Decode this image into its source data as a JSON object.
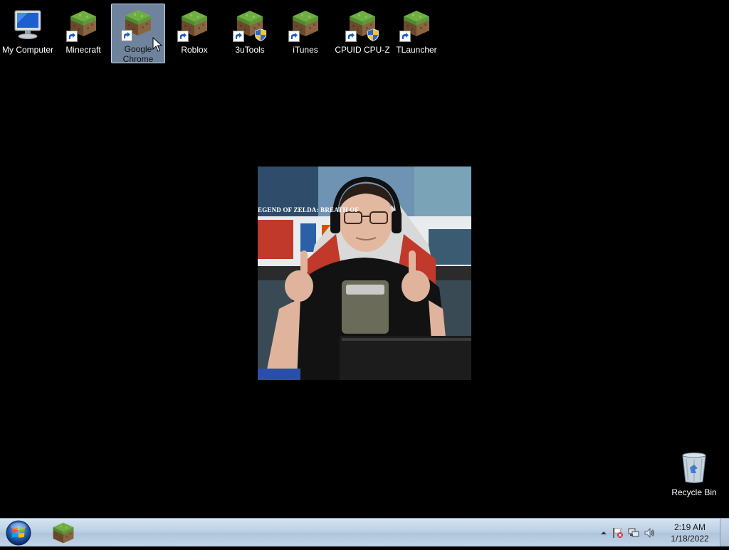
{
  "desktop": {
    "icons": [
      {
        "label": "My Computer",
        "icon": "computer-icon"
      },
      {
        "label": "Minecraft",
        "icon": "minecraft-icon"
      },
      {
        "label": "Google Chrome",
        "icon": "minecraft-icon",
        "selected": true
      },
      {
        "label": "Roblox",
        "icon": "minecraft-icon"
      },
      {
        "label": "3uTools",
        "icon": "minecraft-icon",
        "uac": true
      },
      {
        "label": "iTunes",
        "icon": "minecraft-icon"
      },
      {
        "label": "CPUID CPU-Z",
        "icon": "minecraft-icon",
        "uac": true
      },
      {
        "label": "TLauncher",
        "icon": "minecraft-icon"
      }
    ],
    "recycle_bin": {
      "label": "Recycle Bin",
      "icon": "recycle-bin-icon"
    },
    "wallpaper": {
      "banner_text": "EGEND OF ZELDA: BREATH OF"
    }
  },
  "taskbar": {
    "start_icon": "windows-start-orb-icon",
    "pinned_app_icon": "minecraft-icon",
    "tray": {
      "icons": [
        "show-hidden-icons-chevron",
        "action-center-flag-icon",
        "network-icon",
        "volume-icon"
      ],
      "time": "2:19 AM",
      "date": "1/18/2022"
    }
  },
  "colors": {
    "desktop_bg": "#000000",
    "taskbar_top": "#d6e4f2",
    "taskbar_bottom": "#aec4dc",
    "selection": "#96afd2",
    "grass_green": "#5f9b3a",
    "dirt_brown": "#7a5533"
  }
}
